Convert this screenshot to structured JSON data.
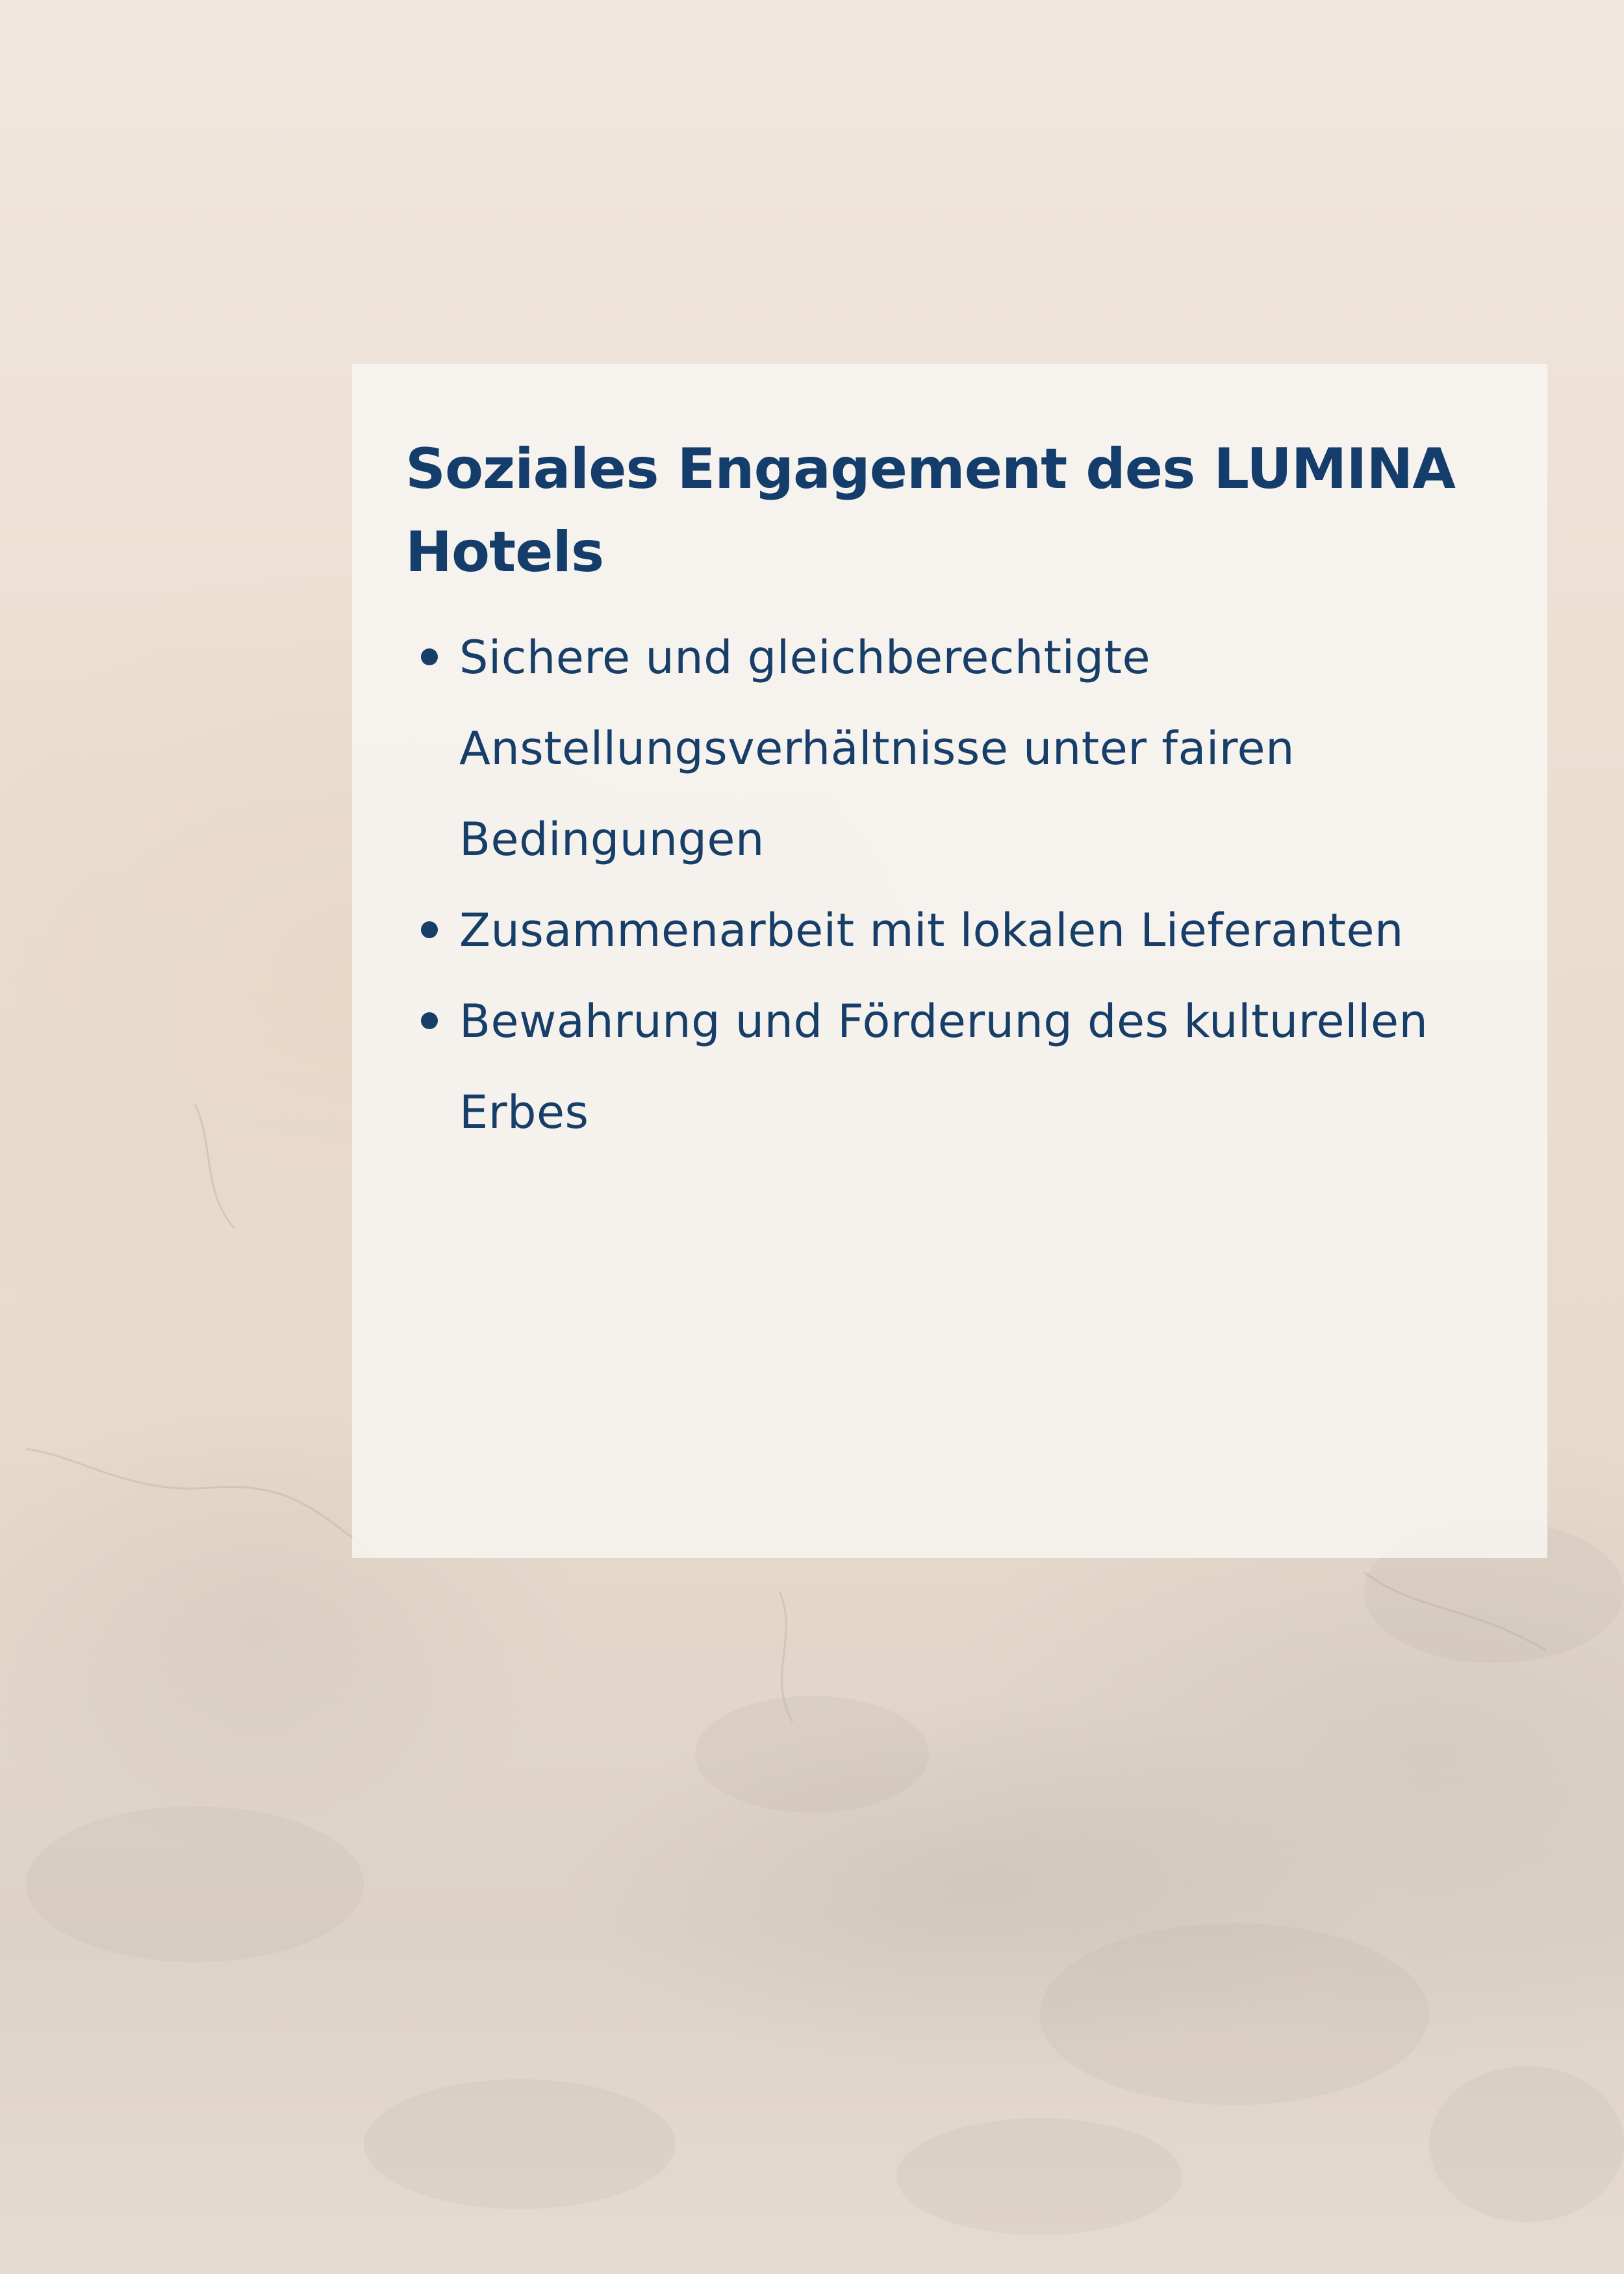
{
  "panel": {
    "title": "Soziales Engagement des LUMINA Hotels",
    "bullets": [
      "Sichere und gleichberechtigte Anstellungsverhältnisse unter fairen Bedingungen",
      "Zusammenarbeit mit lokalen Lieferanten",
      "Bewahrung und Förderung des kulturellen Erbes"
    ]
  },
  "colors": {
    "title": "#143d6b",
    "text": "#173e68",
    "panel_background": "#f8f6f4",
    "page_background": "#ecdfd2"
  }
}
